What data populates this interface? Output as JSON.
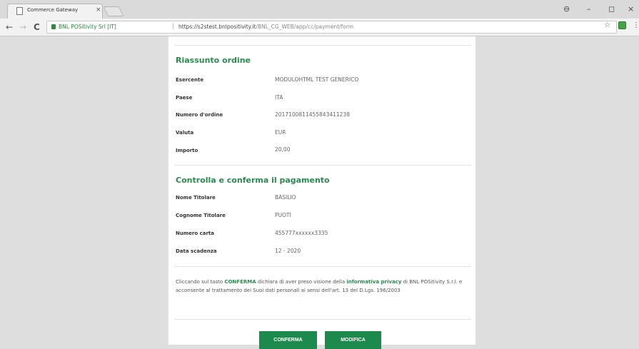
{
  "browser": {
    "tab_title": "Commerce Gateway",
    "tab_close": "×",
    "win_profile": "⊖",
    "win_min": "–",
    "win_max": "◻",
    "win_close": "×",
    "back": "←",
    "forward": "→",
    "reload": "C",
    "site_identity": "BNL POSitivity Srl [IT]",
    "separator": "|",
    "url_main": "https://s2stest.bnlpositivity.it",
    "url_path": "/BNL_CG_WEB/app/cc/payment/form",
    "star": "☆",
    "menu": "⋮"
  },
  "order_summary": {
    "title": "Riassunto ordine",
    "rows": [
      {
        "label": "Esercente",
        "value": "MODULOHTML TEST GENERICO"
      },
      {
        "label": "Paese",
        "value": "ITA"
      },
      {
        "label": "Numero d'ordine",
        "value": "20171008114558434112​38"
      },
      {
        "label": "Valuta",
        "value": "EUR"
      },
      {
        "label": "Importo",
        "value": "20,00"
      }
    ]
  },
  "payment": {
    "title": "Controlla e conferma il pagamento",
    "rows": [
      {
        "label": "Nome Titolare",
        "value": "BASILIO"
      },
      {
        "label": "Cognome Titolare",
        "value": "PUOTI"
      },
      {
        "label": "Numero carta",
        "value": "455777xxxxxx3335"
      },
      {
        "label": "Data scadenza",
        "value": "12 - 2020"
      }
    ]
  },
  "notice": {
    "part1": "Cliccando sul tasto ",
    "conferma": "CONFERMA",
    "part2": " dichiara di aver preso visione della ",
    "privacy": "informativa privacy",
    "part3": " di BNL POSitivity S.r.l. e acconsente al trattamento dei Suoi dati personali ai sensi dell'art. 13 del D.Lgs. 196/2003"
  },
  "actions": {
    "confirm_label": "CONFERMA",
    "modify_label": "MODIFICA"
  }
}
